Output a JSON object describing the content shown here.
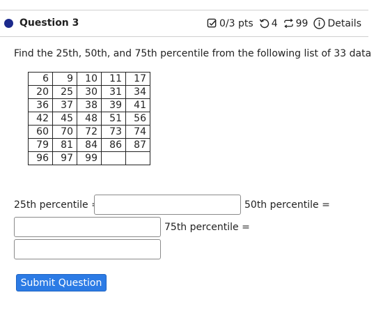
{
  "question": {
    "title": "Question 3",
    "points": "0/3 pts",
    "retries": "4",
    "attempts": "99",
    "details_label": "Details"
  },
  "prompt": "Find the 25th, 50th, and 75th percentile from the following list of 33 data",
  "data_table": [
    [
      "6",
      "9",
      "10",
      "11",
      "17"
    ],
    [
      "20",
      "25",
      "30",
      "31",
      "34"
    ],
    [
      "36",
      "37",
      "38",
      "39",
      "41"
    ],
    [
      "42",
      "45",
      "48",
      "51",
      "56"
    ],
    [
      "60",
      "70",
      "72",
      "73",
      "74"
    ],
    [
      "79",
      "81",
      "84",
      "86",
      "87"
    ],
    [
      "96",
      "97",
      "99",
      "",
      ""
    ]
  ],
  "answers": {
    "p25_label": "25th percentile =",
    "p50_label": "50th percentile =",
    "p75_label": "75th percentile =",
    "p25_value": "",
    "p50_value": "",
    "p75_value": ""
  },
  "submit_label": "Submit Question",
  "colors": {
    "accent": "#2c7be5",
    "question_dot": "#1c2a8c"
  }
}
